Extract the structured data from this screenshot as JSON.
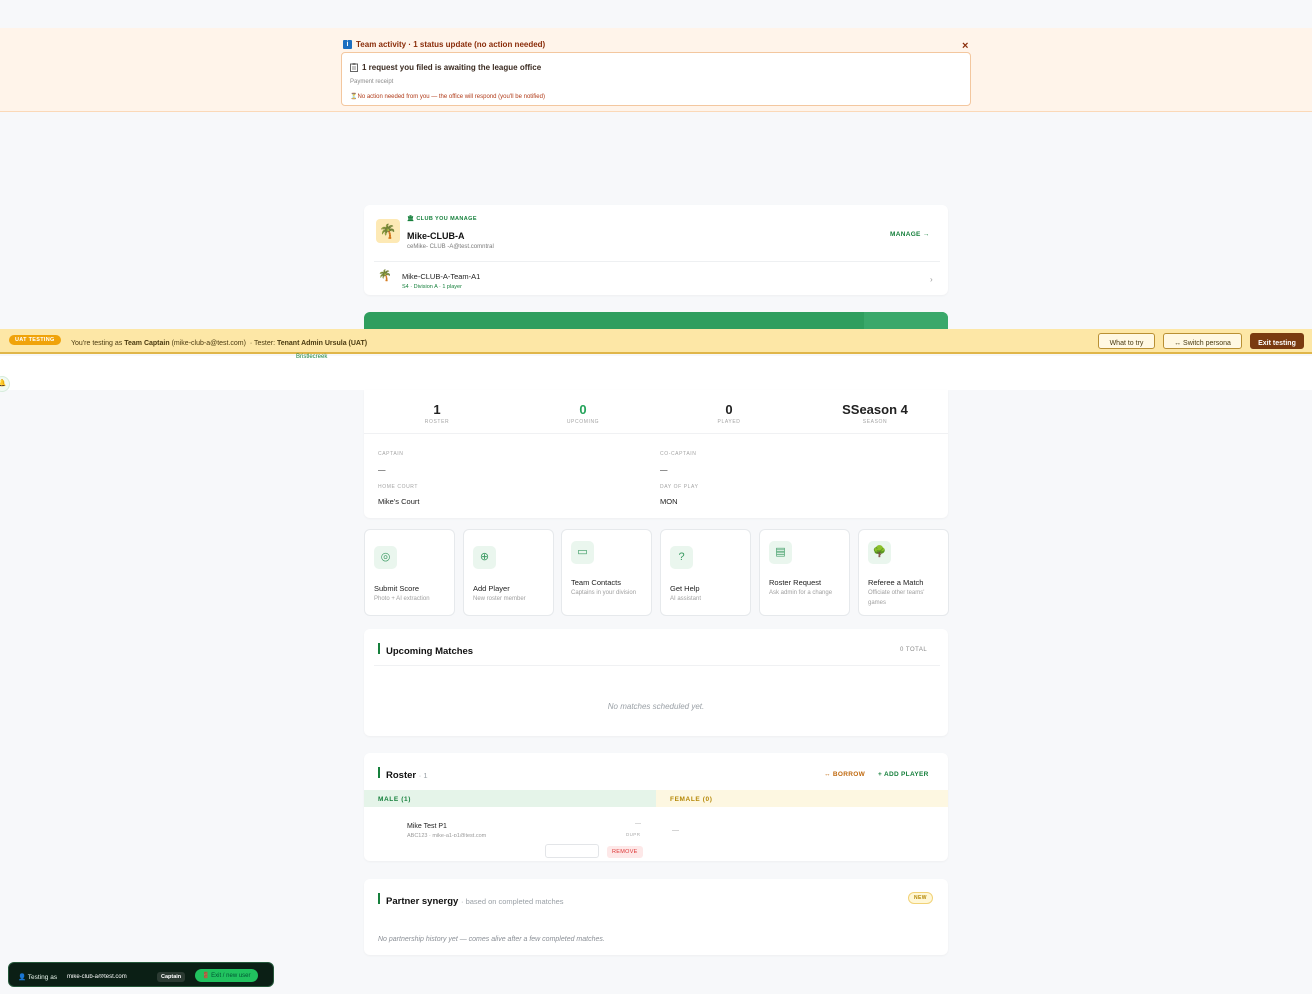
{
  "activity": {
    "title": "Team activity · 1 status update (no action needed)",
    "close": "×",
    "card_title": "1 request you filed is awaiting the league office",
    "card_sub": "Payment receipt",
    "card_note": "No action needed from you — the office will respond (you'll be notified)"
  },
  "club": {
    "kicker": "CLUB YOU MANAGE",
    "name": "Mike-CLUB-A",
    "email": "ceMike- CLUB -A@test.comntral",
    "manage": "MANAGE →",
    "team_name": "Mike-CLUB-A-Team-A1",
    "team_meta": "S4 · Division A · 1 player"
  },
  "uat": {
    "badge": "UAT TESTING",
    "prefix": "You're testing as",
    "role": "Team Captain",
    "email": "(mike-club-a@test.com)",
    "tester_prefix": "· Tester:",
    "tester": "Tenant Admin Ursula (UAT)",
    "what_to_try": "What to try",
    "switch": "↔ Switch persona",
    "exit": "Exit testing",
    "under_text": "Bristlecreek"
  },
  "stats": [
    {
      "value": "1",
      "label": "ROSTER",
      "green": false
    },
    {
      "value": "0",
      "label": "UPCOMING",
      "green": true
    },
    {
      "value": "0",
      "label": "PLAYED",
      "green": false
    },
    {
      "value": "SSeason 4",
      "label": "SEASON",
      "green": false
    }
  ],
  "details": {
    "captain_label": "CAPTAIN",
    "captain": "—",
    "cocaptain_label": "CO-CAPTAIN",
    "cocaptain": "—",
    "court_label": "HOME COURT",
    "court": "Mike's Court",
    "day_label": "DAY OF PLAY",
    "day": "MON"
  },
  "tiles": [
    {
      "title": "Submit Score",
      "sub": "Photo + AI extraction",
      "icon": "camera-icon"
    },
    {
      "title": "Add Player",
      "sub": "New roster member",
      "icon": "add-user-icon"
    },
    {
      "title": "Team Contacts",
      "sub": "Captains in your division",
      "icon": "chat-icon"
    },
    {
      "title": "Get Help",
      "sub": "AI assistant",
      "icon": "help-icon"
    },
    {
      "title": "Roster Request",
      "sub": "Ask admin for a change",
      "icon": "clipboard-icon"
    },
    {
      "title": "Referee a Match",
      "sub": "Officiate other teams' games",
      "icon": "referee-icon"
    }
  ],
  "upcoming": {
    "title": "Upcoming Matches",
    "count": "0 TOTAL",
    "empty": "No matches scheduled yet."
  },
  "roster": {
    "title": "Roster",
    "count": "· 1",
    "borrow": "↔ BORROW",
    "add": "+ ADD PLAYER",
    "male_label": "MALE (1)",
    "female_label": "FEMALE (0)",
    "player_name": "Mike Test P1",
    "player_sub": "ABC123 · mike-a1-p1@test.com",
    "dupr_dash": "—",
    "dupr_label": "DUPR",
    "remove": "REMOVE",
    "female_dash": "—"
  },
  "partner": {
    "title": "Partner synergy",
    "sub": "· based on completed matches",
    "badge": "NEW",
    "empty": "No partnership history yet — comes alive after a few completed matches."
  },
  "testing_pill": {
    "prefix": "Testing as",
    "user": "mike-club-a@test.com",
    "role": "Captain",
    "exit": "Exit / new user"
  },
  "colors": {
    "accent_green": "#16803c",
    "banner_bg": "#fff4ea",
    "uat_bg": "#fde7a6"
  }
}
